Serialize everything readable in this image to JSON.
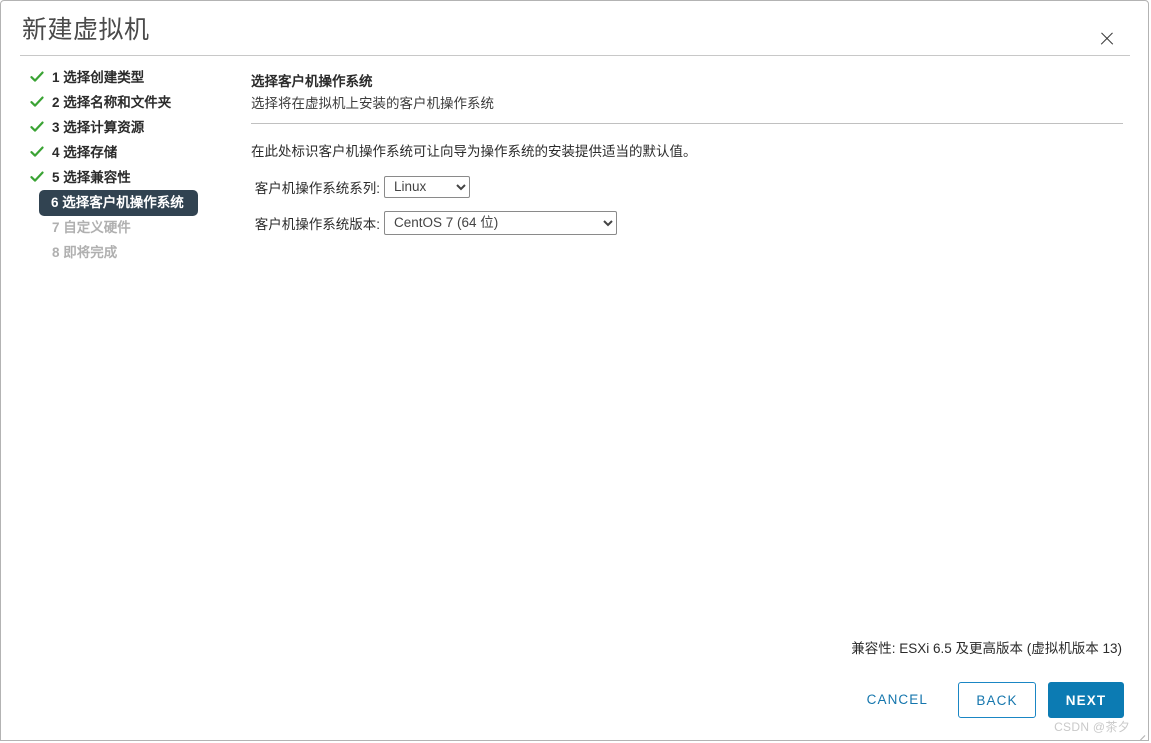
{
  "window": {
    "title": "新建虚拟机",
    "close_icon": "close-icon"
  },
  "steps": [
    {
      "number": "1",
      "label": "1 选择创建类型",
      "state": "done"
    },
    {
      "number": "2",
      "label": "2 选择名称和文件夹",
      "state": "done"
    },
    {
      "number": "3",
      "label": "3 选择计算资源",
      "state": "done"
    },
    {
      "number": "4",
      "label": "4 选择存储",
      "state": "done"
    },
    {
      "number": "5",
      "label": "5 选择兼容性",
      "state": "done"
    },
    {
      "number": "6",
      "label": "6 选择客户机操作系统",
      "state": "active"
    },
    {
      "number": "7",
      "label": "7 自定义硬件",
      "state": "pending"
    },
    {
      "number": "8",
      "label": "8 即将完成",
      "state": "pending"
    }
  ],
  "main": {
    "heading": "选择客户机操作系统",
    "subheading": "选择将在虚拟机上安装的客户机操作系统",
    "hint": "在此处标识客户机操作系统可让向导为操作系统的安装提供适当的默认值。",
    "fields": {
      "family": {
        "label": "客户机操作系统系列:",
        "value": "Linux",
        "options": [
          "Linux"
        ]
      },
      "version": {
        "label": "客户机操作系统版本:",
        "value": "CentOS 7 (64 位)",
        "options": [
          "CentOS 7 (64 位)"
        ]
      }
    }
  },
  "footer": {
    "compatibility": "兼容性: ESXi 6.5 及更高版本 (虚拟机版本 13)",
    "cancel_label": "CANCEL",
    "back_label": "BACK",
    "next_label": "NEXT"
  },
  "watermark": "CSDN @茶夕",
  "colors": {
    "accent_blue": "#0c7bb3",
    "link_blue": "#1576ad",
    "active_step_bg": "#314351",
    "check_green": "#3aa334",
    "pending_text": "#b0b0b0"
  }
}
